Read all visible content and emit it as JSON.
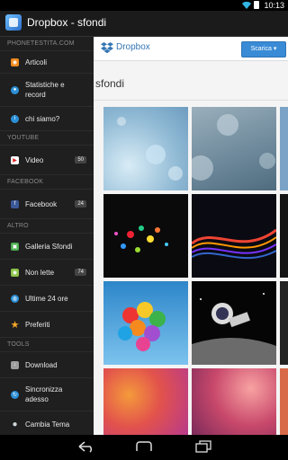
{
  "status": {
    "time": "10:13"
  },
  "app": {
    "title": "Dropbox - sfondi"
  },
  "drawer": {
    "sections": [
      {
        "label": "PHONETESTITA.COM",
        "items": [
          {
            "label": "Articoli",
            "icon": "rss-icon",
            "color": "#f08a1e"
          },
          {
            "label": "Statistiche e record",
            "icon": "stats-icon",
            "color": "#2b8fd6"
          },
          {
            "label": "chi siamo?",
            "icon": "info-icon",
            "color": "#2b8fd6"
          }
        ]
      },
      {
        "label": "YOUTUBE",
        "items": [
          {
            "label": "Video",
            "icon": "youtube-icon",
            "color": "#d22",
            "badge": "50"
          }
        ]
      },
      {
        "label": "FACEBOOK",
        "items": [
          {
            "label": "Facebook",
            "icon": "facebook-icon",
            "color": "#3b5998",
            "badge": "24"
          }
        ]
      },
      {
        "label": "ALTRO",
        "items": [
          {
            "label": "Galleria Sfondi",
            "icon": "gallery-icon",
            "color": "#4caf50"
          },
          {
            "label": "Non lette",
            "icon": "rss-icon",
            "color": "#8bc34a",
            "badge": "74"
          },
          {
            "label": "Ultime 24 ore",
            "icon": "globe-icon",
            "color": "#2b8fd6"
          },
          {
            "label": "Preferiti",
            "icon": "star-icon",
            "color": "#f4a62a"
          }
        ]
      },
      {
        "label": "TOOLS",
        "items": [
          {
            "label": "Download",
            "icon": "download-icon",
            "color": "#9e9e9e"
          },
          {
            "label": "Sincronizza adesso",
            "icon": "sync-icon",
            "color": "#2b8fd6"
          },
          {
            "label": "Cambia Tema",
            "icon": "bulb-icon",
            "color": "#cfd8dc"
          }
        ]
      }
    ]
  },
  "dropbox": {
    "title": "Dropbox",
    "download_button": "Scarica ▾",
    "folder": "sfondi"
  },
  "colors": {
    "accent": "#3a8bd6",
    "drawer_bg": "#1f1f1f"
  }
}
